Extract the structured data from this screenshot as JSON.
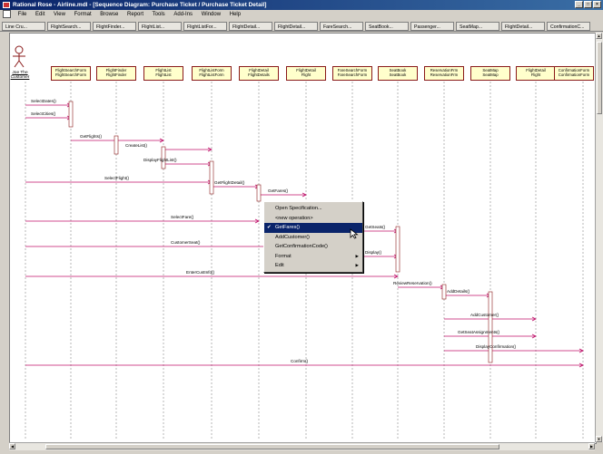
{
  "window": {
    "title": "Rational Rose - Airline.mdl - [Sequence Diagram: Purchase Ticket / Purchase Ticket Detail]",
    "controls": [
      "_",
      "□",
      "×"
    ]
  },
  "menubar": [
    "File",
    "Edit",
    "View",
    "Format",
    "Browse",
    "Report",
    "Tools",
    "Add-Ins",
    "Window",
    "Help"
  ],
  "tabs": [
    "Line Cru...",
    "FlightSearch...",
    "FlightFinder...",
    "FlightList...",
    "FlightListFor...",
    "FlightDetail...",
    "FlightDetail...",
    "FareSearch...",
    "SeatBook...",
    "Passenger...",
    "SeatMap...",
    "FlightDetail...",
    "ConfirmationC..."
  ],
  "actor": {
    "label": "Joe The Customer"
  },
  "objects": [
    {
      "name": "FlightSearchForm",
      "type": "FlightSearchForm"
    },
    {
      "name": "FlightFinder",
      "type": "FlightFinder"
    },
    {
      "name": "FlightList",
      "type": "FlightList"
    },
    {
      "name": "FlightListForm",
      "type": "FlightListForm"
    },
    {
      "name": "FlightDetail",
      "type": "FlightDetails"
    },
    {
      "name": "FlightDetail",
      "type": "Flight"
    },
    {
      "name": "FareSearchForm",
      "type": "FareSearchForm"
    },
    {
      "name": "SeatBook",
      "type": "SeatBook"
    },
    {
      "name": "ReservationFrm",
      "type": "ReservationFrm"
    },
    {
      "name": "SeatMap",
      "type": "SeatMap"
    },
    {
      "name": "FlightDetail",
      "type": "Flight"
    },
    {
      "name": "ConfirmationForm",
      "type": "ConfirmationForm"
    }
  ],
  "messages": [
    "SelectDates()",
    "SelectCities()",
    "GetFlights()",
    "CreateList()",
    "DisplayFlightList()",
    "SelectFlight()",
    "GetFlightDetail()",
    "GetFares()",
    "SelectFare()",
    "GetSeats()",
    "CustomerSeat()",
    "Display()",
    "EnterCustInfo()",
    "ReviewReservation()",
    "AddDetails()",
    "AddCustomer()",
    "GetSeatAssignments()",
    "DisplayConfirmation()",
    "Confirm()"
  ],
  "context_menu": {
    "items": [
      {
        "label": "Open Specification...",
        "checked": false,
        "submenu": false,
        "selected": false
      },
      {
        "label": "<new operation>",
        "checked": false,
        "submenu": false,
        "selected": false
      },
      {
        "label": "GetFares()",
        "checked": true,
        "submenu": false,
        "selected": true
      },
      {
        "label": "AddCustomer()",
        "checked": false,
        "submenu": false,
        "selected": false
      },
      {
        "label": "GetConfirmationCode()",
        "checked": false,
        "submenu": false,
        "selected": false
      },
      {
        "label": "Format",
        "checked": false,
        "submenu": true,
        "selected": false
      },
      {
        "label": "Edit",
        "checked": false,
        "submenu": true,
        "selected": false
      }
    ]
  },
  "colors": {
    "titlebar": "#0a246a",
    "object_fill": "#ffffcc",
    "object_border": "#8a1a1a",
    "message_line": "#c0106a",
    "lifeline": "#888888",
    "menu_selected": "#0a246a"
  }
}
